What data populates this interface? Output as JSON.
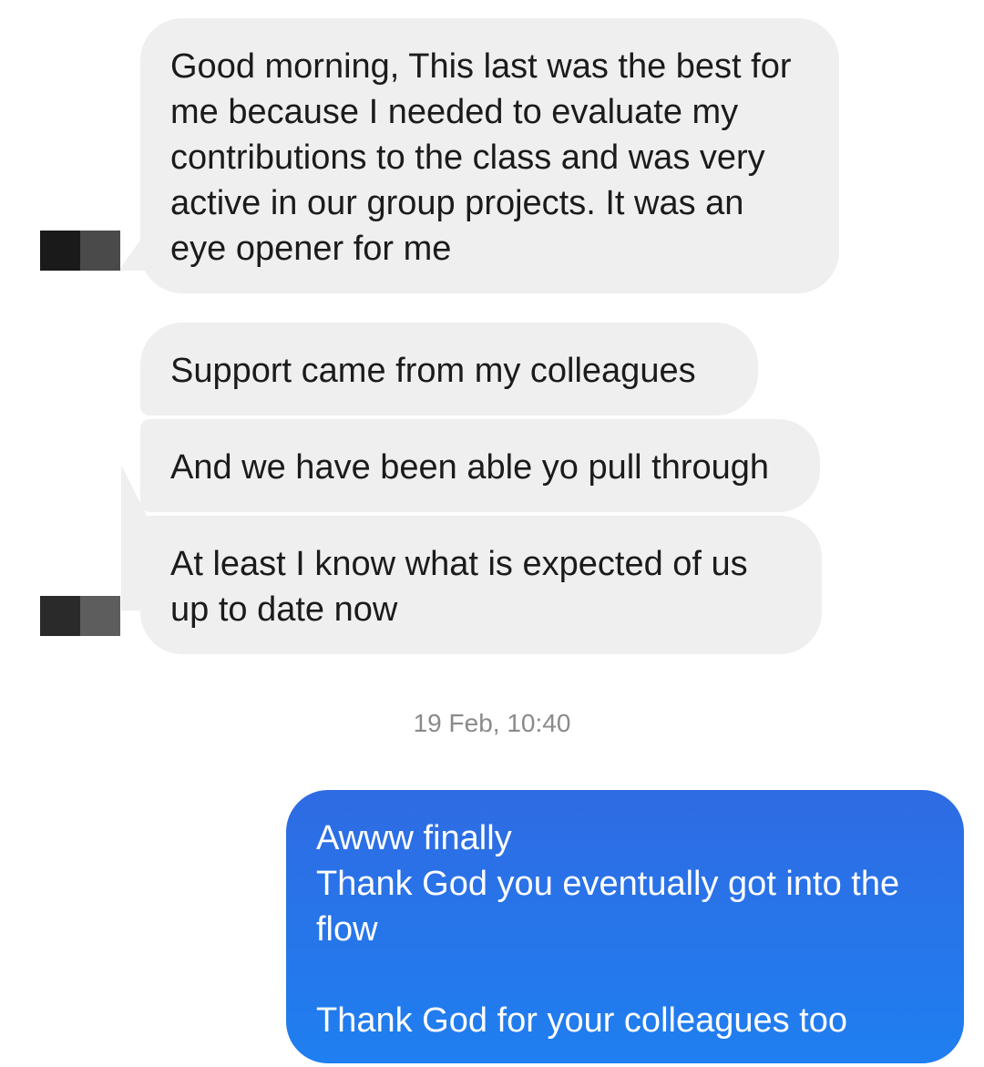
{
  "conversation": {
    "incoming_messages": [
      "Good morning, This last was the best for me because I needed to evaluate my contributions to the class and was very active in our group projects. It was an eye opener for me",
      "Support came from my colleagues",
      "And we have been able yo pull through",
      "At least I know what is expected of us up to date now"
    ],
    "timestamp": "19 Feb, 10:40",
    "outgoing_messages": [
      "Awww finally\nThank God you eventually got into the flow\n\nThank God for your colleagues too"
    ]
  },
  "colors": {
    "incoming_bubble": "#efefef",
    "incoming_text": "#1b1b1b",
    "outgoing_bubble_top": "#2f6be3",
    "outgoing_bubble_bottom": "#1f7ff0",
    "outgoing_text": "#ffffff",
    "timestamp_text": "#8a8a8a"
  },
  "avatars": {
    "first": "blurred-avatar",
    "second": "blurred-avatar"
  }
}
